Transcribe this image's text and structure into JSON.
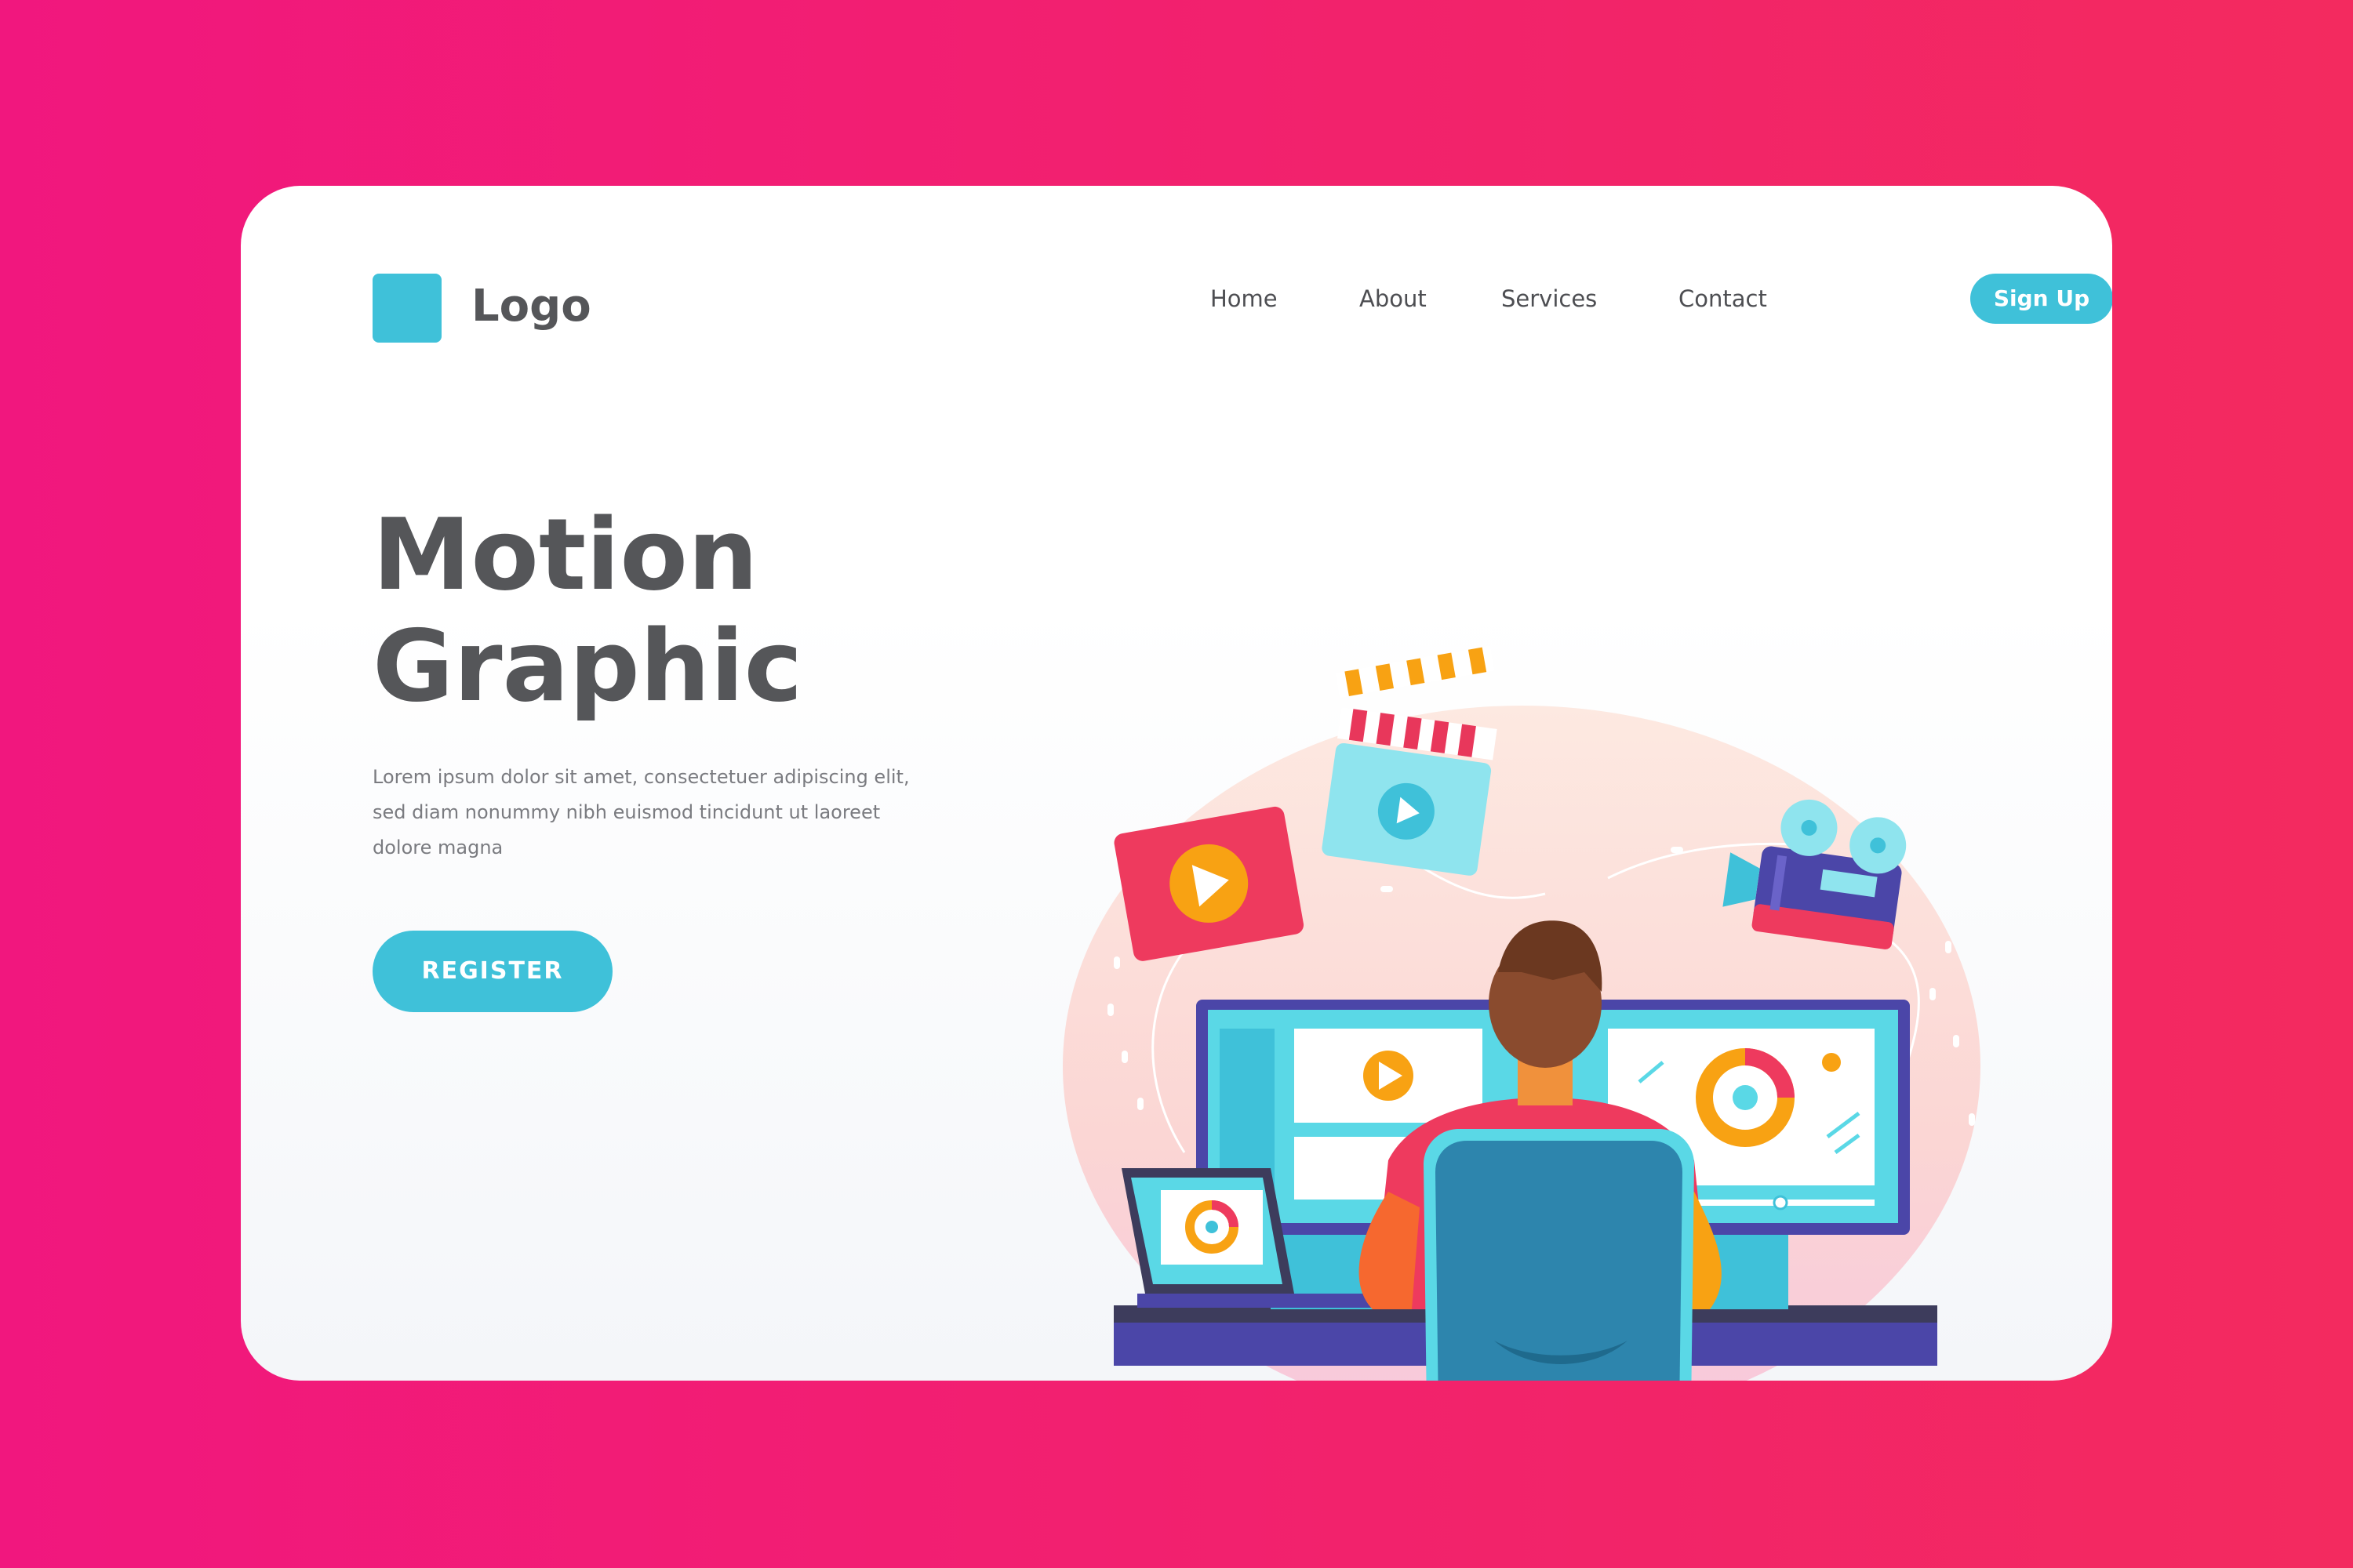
{
  "brand": {
    "logo_text": "Logo"
  },
  "nav": {
    "items": [
      {
        "label": "Home"
      },
      {
        "label": "About"
      },
      {
        "label": "Services"
      },
      {
        "label": "Contact"
      }
    ],
    "cta_label": "Sign Up"
  },
  "hero": {
    "title_line1": "Motion",
    "title_line2": "Graphic",
    "description": [
      "Lorem ipsum dolor sit amet, consectetuer adipiscing elit,",
      "sed diam nonummy nibh euismod tincidunt ut laoreet",
      "dolore magna"
    ],
    "cta_label": "REGISTER"
  },
  "colors": {
    "background_gradient_start": "#f1177e",
    "background_gradient_end": "#f32a5f",
    "accent": "#3fc1d9",
    "text_dark": "#555659",
    "text_muted": "#7a7b80"
  },
  "illustration": {
    "icons": [
      "video-player-icon",
      "clapperboard-icon",
      "film-camera-icon",
      "monitor-icon",
      "laptop-icon",
      "donut-chart-icon",
      "office-chair-icon"
    ]
  }
}
